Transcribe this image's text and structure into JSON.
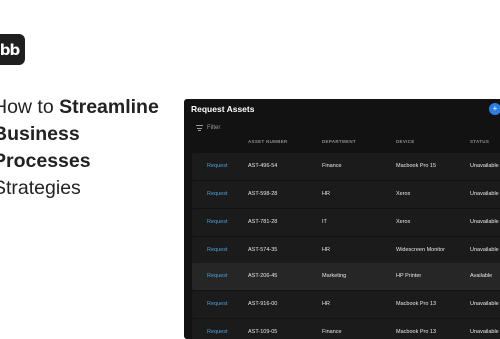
{
  "logo": {
    "text": "bb"
  },
  "headline": {
    "line1_plain": "How to ",
    "line1_bold": "Streamline",
    "line2_bold": "Business Processes",
    "line3": "Strategies"
  },
  "panel": {
    "title": "Request Assets",
    "filter_label": "Filter",
    "columns": [
      "ASSET NUMBER",
      "DEPARTMENT",
      "DEVICE",
      "STATUS"
    ],
    "rows": [
      {
        "action": "Request",
        "asset": "AST-496-54",
        "dept": "Finance",
        "device": "Macbook Pro 15",
        "status": "Unavailable"
      },
      {
        "action": "Request",
        "asset": "AST-598-28",
        "dept": "HR",
        "device": "Xerox",
        "status": "Unavailable"
      },
      {
        "action": "Request",
        "asset": "AST-781-28",
        "dept": "IT",
        "device": "Xerox",
        "status": "Unavailable"
      },
      {
        "action": "Request",
        "asset": "AST-574-35",
        "dept": "HR",
        "device": "Widescreen Monitor",
        "status": "Unavailable"
      },
      {
        "action": "Request",
        "asset": "AST-206-45",
        "dept": "Marketing",
        "device": "HP Printer",
        "status": "Available"
      },
      {
        "action": "Request",
        "asset": "AST-916-00",
        "dept": "HR",
        "device": "Macbook Pro 13",
        "status": "Unavailable"
      },
      {
        "action": "Request",
        "asset": "AST-109-05",
        "dept": "Finance",
        "device": "Macbook Pro 13",
        "status": "Unavailable"
      }
    ]
  }
}
